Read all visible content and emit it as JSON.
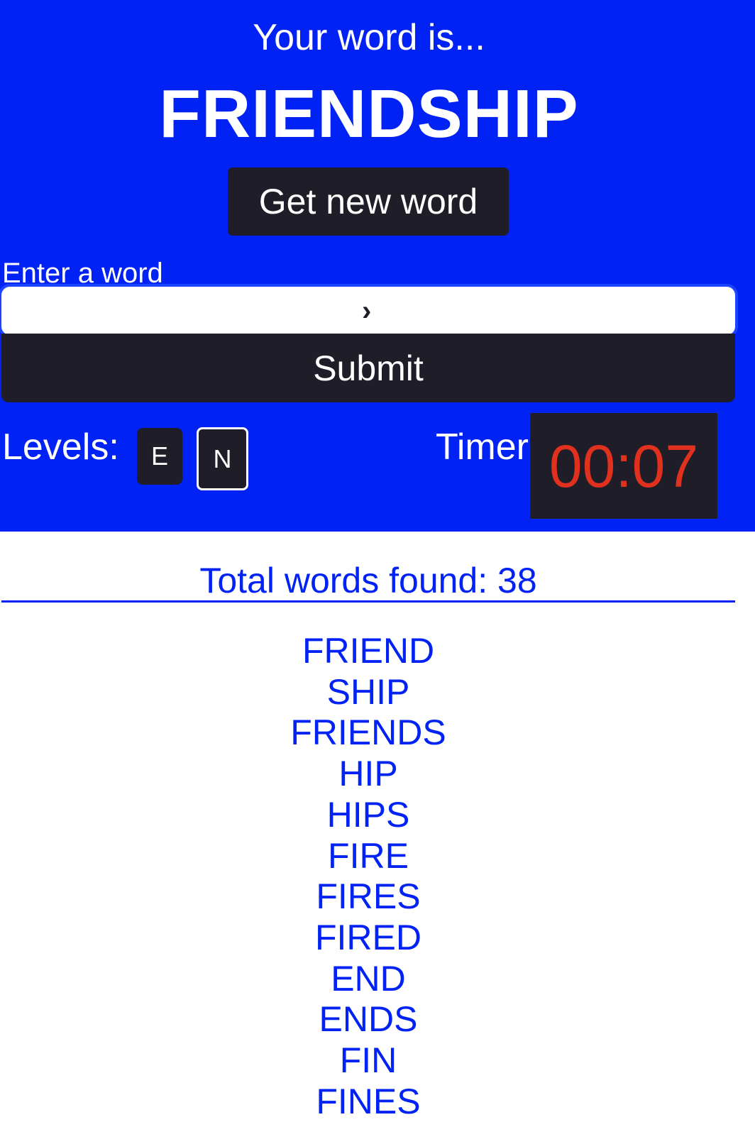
{
  "header": {
    "intro": "Your word is...",
    "current_word": "FRIENDSHIP",
    "new_word_button": "Get new word"
  },
  "form": {
    "label": "Enter a word",
    "input_value": "",
    "input_placeholder": "",
    "caret_glyph": "›",
    "submit_button": "Submit"
  },
  "levels": {
    "label": "Levels:",
    "options": [
      {
        "label": "E",
        "selected": false
      },
      {
        "label": "N",
        "selected": true
      }
    ]
  },
  "timer": {
    "label": "Timer",
    "value": "00:07"
  },
  "results": {
    "total_label": "Total words found: 38",
    "total_count": 38,
    "words": [
      "FRIEND",
      "SHIP",
      "FRIENDS",
      "HIP",
      "HIPS",
      "FIRE",
      "FIRES",
      "FIRED",
      "END",
      "ENDS",
      "FIN",
      "FINES"
    ]
  },
  "colors": {
    "primary_blue": "#0022f5",
    "dark": "#1f1d27",
    "timer_red": "#e0301e",
    "focus_ring": "#1a44ff"
  }
}
